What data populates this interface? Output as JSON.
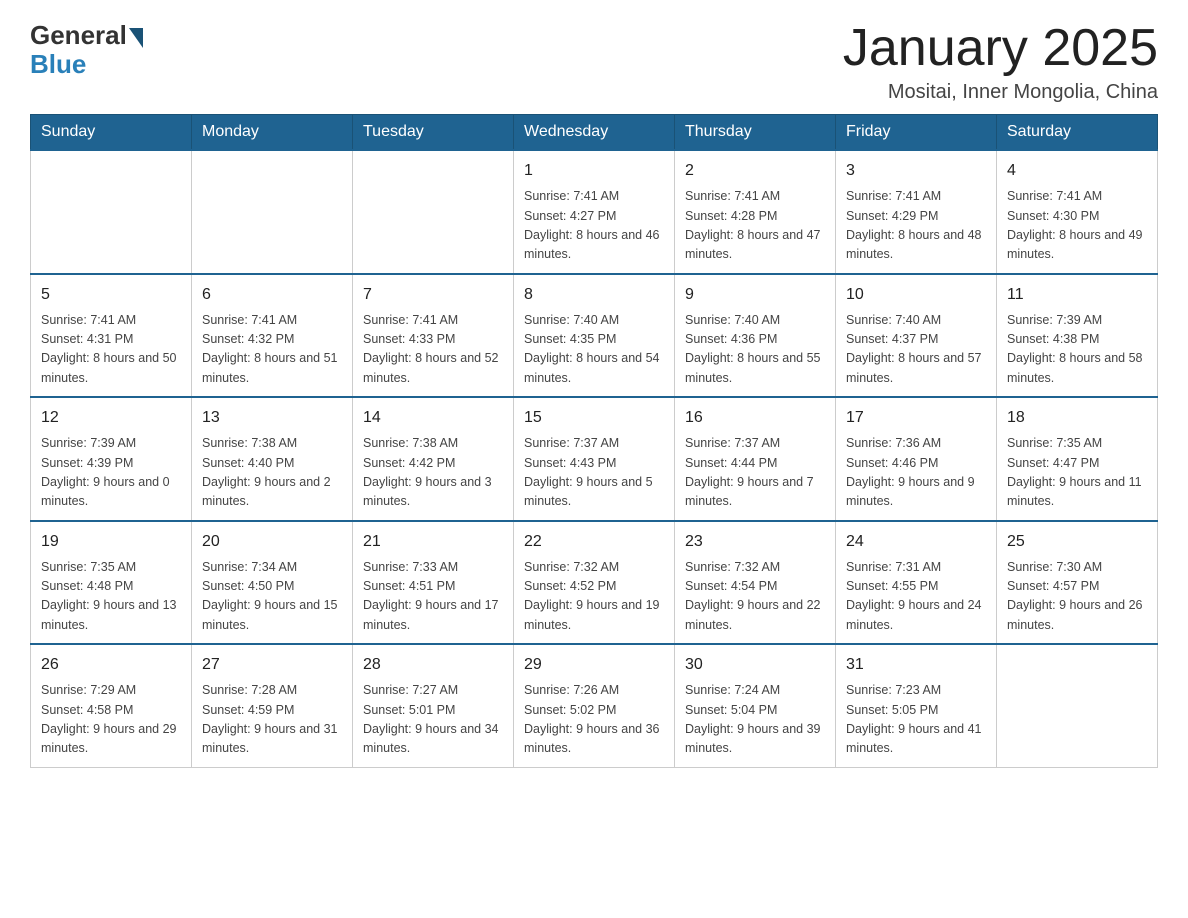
{
  "header": {
    "logo_general": "General",
    "logo_blue": "Blue",
    "title": "January 2025",
    "location": "Mositai, Inner Mongolia, China"
  },
  "days_of_week": [
    "Sunday",
    "Monday",
    "Tuesday",
    "Wednesday",
    "Thursday",
    "Friday",
    "Saturday"
  ],
  "weeks": [
    [
      {
        "day": "",
        "info": ""
      },
      {
        "day": "",
        "info": ""
      },
      {
        "day": "",
        "info": ""
      },
      {
        "day": "1",
        "info": "Sunrise: 7:41 AM\nSunset: 4:27 PM\nDaylight: 8 hours\nand 46 minutes."
      },
      {
        "day": "2",
        "info": "Sunrise: 7:41 AM\nSunset: 4:28 PM\nDaylight: 8 hours\nand 47 minutes."
      },
      {
        "day": "3",
        "info": "Sunrise: 7:41 AM\nSunset: 4:29 PM\nDaylight: 8 hours\nand 48 minutes."
      },
      {
        "day": "4",
        "info": "Sunrise: 7:41 AM\nSunset: 4:30 PM\nDaylight: 8 hours\nand 49 minutes."
      }
    ],
    [
      {
        "day": "5",
        "info": "Sunrise: 7:41 AM\nSunset: 4:31 PM\nDaylight: 8 hours\nand 50 minutes."
      },
      {
        "day": "6",
        "info": "Sunrise: 7:41 AM\nSunset: 4:32 PM\nDaylight: 8 hours\nand 51 minutes."
      },
      {
        "day": "7",
        "info": "Sunrise: 7:41 AM\nSunset: 4:33 PM\nDaylight: 8 hours\nand 52 minutes."
      },
      {
        "day": "8",
        "info": "Sunrise: 7:40 AM\nSunset: 4:35 PM\nDaylight: 8 hours\nand 54 minutes."
      },
      {
        "day": "9",
        "info": "Sunrise: 7:40 AM\nSunset: 4:36 PM\nDaylight: 8 hours\nand 55 minutes."
      },
      {
        "day": "10",
        "info": "Sunrise: 7:40 AM\nSunset: 4:37 PM\nDaylight: 8 hours\nand 57 minutes."
      },
      {
        "day": "11",
        "info": "Sunrise: 7:39 AM\nSunset: 4:38 PM\nDaylight: 8 hours\nand 58 minutes."
      }
    ],
    [
      {
        "day": "12",
        "info": "Sunrise: 7:39 AM\nSunset: 4:39 PM\nDaylight: 9 hours\nand 0 minutes."
      },
      {
        "day": "13",
        "info": "Sunrise: 7:38 AM\nSunset: 4:40 PM\nDaylight: 9 hours\nand 2 minutes."
      },
      {
        "day": "14",
        "info": "Sunrise: 7:38 AM\nSunset: 4:42 PM\nDaylight: 9 hours\nand 3 minutes."
      },
      {
        "day": "15",
        "info": "Sunrise: 7:37 AM\nSunset: 4:43 PM\nDaylight: 9 hours\nand 5 minutes."
      },
      {
        "day": "16",
        "info": "Sunrise: 7:37 AM\nSunset: 4:44 PM\nDaylight: 9 hours\nand 7 minutes."
      },
      {
        "day": "17",
        "info": "Sunrise: 7:36 AM\nSunset: 4:46 PM\nDaylight: 9 hours\nand 9 minutes."
      },
      {
        "day": "18",
        "info": "Sunrise: 7:35 AM\nSunset: 4:47 PM\nDaylight: 9 hours\nand 11 minutes."
      }
    ],
    [
      {
        "day": "19",
        "info": "Sunrise: 7:35 AM\nSunset: 4:48 PM\nDaylight: 9 hours\nand 13 minutes."
      },
      {
        "day": "20",
        "info": "Sunrise: 7:34 AM\nSunset: 4:50 PM\nDaylight: 9 hours\nand 15 minutes."
      },
      {
        "day": "21",
        "info": "Sunrise: 7:33 AM\nSunset: 4:51 PM\nDaylight: 9 hours\nand 17 minutes."
      },
      {
        "day": "22",
        "info": "Sunrise: 7:32 AM\nSunset: 4:52 PM\nDaylight: 9 hours\nand 19 minutes."
      },
      {
        "day": "23",
        "info": "Sunrise: 7:32 AM\nSunset: 4:54 PM\nDaylight: 9 hours\nand 22 minutes."
      },
      {
        "day": "24",
        "info": "Sunrise: 7:31 AM\nSunset: 4:55 PM\nDaylight: 9 hours\nand 24 minutes."
      },
      {
        "day": "25",
        "info": "Sunrise: 7:30 AM\nSunset: 4:57 PM\nDaylight: 9 hours\nand 26 minutes."
      }
    ],
    [
      {
        "day": "26",
        "info": "Sunrise: 7:29 AM\nSunset: 4:58 PM\nDaylight: 9 hours\nand 29 minutes."
      },
      {
        "day": "27",
        "info": "Sunrise: 7:28 AM\nSunset: 4:59 PM\nDaylight: 9 hours\nand 31 minutes."
      },
      {
        "day": "28",
        "info": "Sunrise: 7:27 AM\nSunset: 5:01 PM\nDaylight: 9 hours\nand 34 minutes."
      },
      {
        "day": "29",
        "info": "Sunrise: 7:26 AM\nSunset: 5:02 PM\nDaylight: 9 hours\nand 36 minutes."
      },
      {
        "day": "30",
        "info": "Sunrise: 7:24 AM\nSunset: 5:04 PM\nDaylight: 9 hours\nand 39 minutes."
      },
      {
        "day": "31",
        "info": "Sunrise: 7:23 AM\nSunset: 5:05 PM\nDaylight: 9 hours\nand 41 minutes."
      },
      {
        "day": "",
        "info": ""
      }
    ]
  ]
}
